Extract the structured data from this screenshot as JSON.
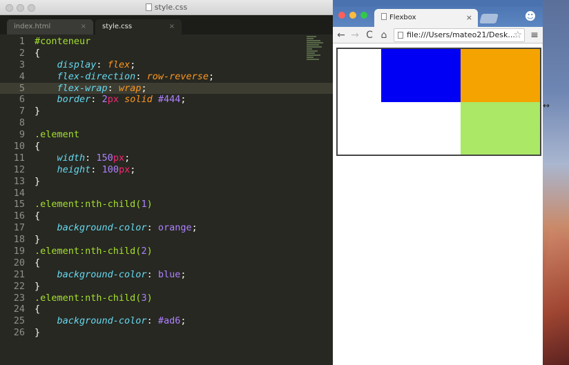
{
  "editor": {
    "window_title": "style.css",
    "tabs": [
      {
        "label": "index.html",
        "active": false,
        "close": "×"
      },
      {
        "label": "style.css",
        "active": true,
        "close": "×"
      }
    ],
    "lines": [
      {
        "n": "1",
        "tokens": [
          [
            "sel",
            "#conteneur"
          ]
        ]
      },
      {
        "n": "2",
        "tokens": [
          [
            "",
            "{"
          ]
        ]
      },
      {
        "n": "3",
        "tokens": [
          [
            "",
            "    "
          ],
          [
            "prop",
            "display"
          ],
          [
            "",
            ": "
          ],
          [
            "val",
            "flex"
          ],
          [
            "",
            ";"
          ]
        ]
      },
      {
        "n": "4",
        "tokens": [
          [
            "",
            "    "
          ],
          [
            "prop",
            "flex-direction"
          ],
          [
            "",
            ": "
          ],
          [
            "val",
            "row-reverse"
          ],
          [
            "",
            ";"
          ]
        ]
      },
      {
        "n": "5",
        "tokens": [
          [
            "",
            "    "
          ],
          [
            "prop",
            "flex-wrap"
          ],
          [
            "",
            ": "
          ],
          [
            "val",
            "wrap"
          ],
          [
            "",
            ";"
          ]
        ],
        "current": true
      },
      {
        "n": "6",
        "tokens": [
          [
            "",
            "    "
          ],
          [
            "prop",
            "border"
          ],
          [
            "",
            ": "
          ],
          [
            "num",
            "2"
          ],
          [
            "unit",
            "px"
          ],
          [
            "",
            " "
          ],
          [
            "val",
            "solid"
          ],
          [
            "",
            " "
          ],
          [
            "num",
            "#444"
          ],
          [
            "",
            ";"
          ]
        ]
      },
      {
        "n": "7",
        "tokens": [
          [
            "",
            "}"
          ]
        ]
      },
      {
        "n": "8",
        "tokens": []
      },
      {
        "n": "9",
        "tokens": [
          [
            "sel",
            ".element"
          ]
        ]
      },
      {
        "n": "10",
        "tokens": [
          [
            "",
            "{"
          ]
        ]
      },
      {
        "n": "11",
        "tokens": [
          [
            "",
            "    "
          ],
          [
            "prop",
            "width"
          ],
          [
            "",
            ": "
          ],
          [
            "num",
            "150"
          ],
          [
            "unit",
            "px"
          ],
          [
            "",
            ";"
          ]
        ]
      },
      {
        "n": "12",
        "tokens": [
          [
            "",
            "    "
          ],
          [
            "prop",
            "height"
          ],
          [
            "",
            ": "
          ],
          [
            "num",
            "100"
          ],
          [
            "unit",
            "px"
          ],
          [
            "",
            ";"
          ]
        ]
      },
      {
        "n": "13",
        "tokens": [
          [
            "",
            "}"
          ]
        ]
      },
      {
        "n": "14",
        "tokens": []
      },
      {
        "n": "15",
        "tokens": [
          [
            "sel",
            ".element:nth-child("
          ],
          [
            "num",
            "1"
          ],
          [
            "sel",
            ")"
          ]
        ]
      },
      {
        "n": "16",
        "tokens": [
          [
            "",
            "{"
          ]
        ]
      },
      {
        "n": "17",
        "tokens": [
          [
            "",
            "    "
          ],
          [
            "prop",
            "background-color"
          ],
          [
            "",
            ": "
          ],
          [
            "num",
            "orange"
          ],
          [
            "",
            ";"
          ]
        ]
      },
      {
        "n": "18",
        "tokens": [
          [
            "",
            "}"
          ]
        ]
      },
      {
        "n": "19",
        "tokens": [
          [
            "sel",
            ".element:nth-child("
          ],
          [
            "num",
            "2"
          ],
          [
            "sel",
            ")"
          ]
        ]
      },
      {
        "n": "20",
        "tokens": [
          [
            "",
            "{"
          ]
        ]
      },
      {
        "n": "21",
        "tokens": [
          [
            "",
            "    "
          ],
          [
            "prop",
            "background-color"
          ],
          [
            "",
            ": "
          ],
          [
            "num",
            "blue"
          ],
          [
            "",
            ";"
          ]
        ]
      },
      {
        "n": "22",
        "tokens": [
          [
            "",
            "}"
          ]
        ]
      },
      {
        "n": "23",
        "tokens": [
          [
            "sel",
            ".element:nth-child("
          ],
          [
            "num",
            "3"
          ],
          [
            "sel",
            ")"
          ]
        ]
      },
      {
        "n": "24",
        "tokens": [
          [
            "",
            "{"
          ]
        ]
      },
      {
        "n": "25",
        "tokens": [
          [
            "",
            "    "
          ],
          [
            "prop",
            "background-color"
          ],
          [
            "",
            ": "
          ],
          [
            "num",
            "#ad6"
          ],
          [
            "",
            ";"
          ]
        ]
      },
      {
        "n": "26",
        "tokens": [
          [
            "",
            "}"
          ]
        ]
      }
    ]
  },
  "browser": {
    "tab_title": "Flexbox",
    "tab_close": "×",
    "url": "file:///Users/mateo21/Desk...",
    "nav": {
      "back": "←",
      "forward": "→",
      "reload": "C",
      "home": "⌂",
      "star": "☆",
      "menu": "≡"
    },
    "boxes": [
      {
        "name": "element-1",
        "color": "#f5a300"
      },
      {
        "name": "element-2",
        "color": "#0000f5"
      },
      {
        "name": "element-3",
        "color": "#aae866"
      }
    ]
  }
}
